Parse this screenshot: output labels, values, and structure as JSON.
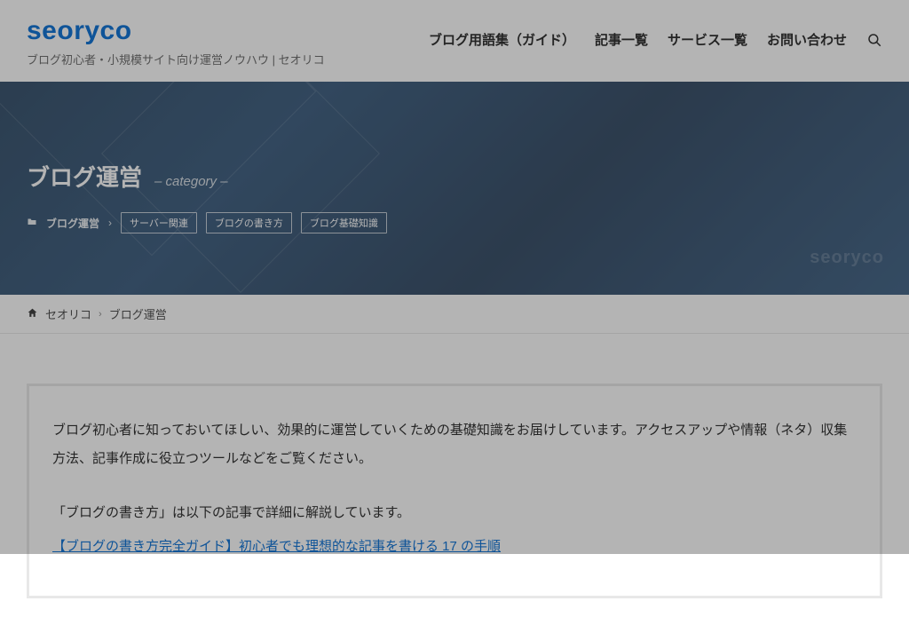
{
  "brand": {
    "logo": "seoryco",
    "tagline": "ブログ初心者・小規模サイト向け運営ノウハウ | セオリコ"
  },
  "nav": {
    "items": [
      "ブログ用語集（ガイド）",
      "記事一覧",
      "サービス一覧",
      "お問い合わせ"
    ]
  },
  "hero": {
    "title": "ブログ運営",
    "suffix": "– category –",
    "watermark": "seoryco",
    "current_category": "ブログ運営",
    "subcategories": [
      "サーバー関連",
      "ブログの書き方",
      "ブログ基礎知識"
    ]
  },
  "breadcrumb": {
    "home": "セオリコ",
    "current": "ブログ運営"
  },
  "content": {
    "intro": "ブログ初心者に知っておいてほしい、効果的に運営していくための基礎知識をお届けしています。アクセスアップや情報（ネタ）収集方法、記事作成に役立つツールなどをご覧ください。",
    "lead": "「ブログの書き方」は以下の記事で詳細に解説しています。",
    "guide_link": "【ブログの書き方完全ガイド】初心者でも理想的な記事を書ける 17 の手順"
  }
}
